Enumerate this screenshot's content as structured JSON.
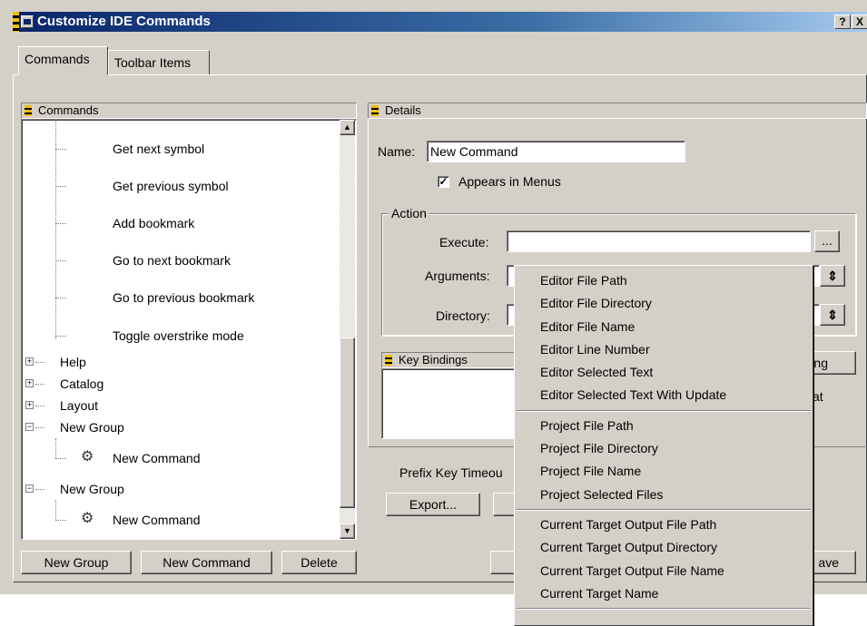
{
  "window": {
    "title": "Customize IDE Commands",
    "help_button": "?",
    "close_button": "X"
  },
  "tabs": [
    {
      "label": "Commands",
      "active": true
    },
    {
      "label": "Toolbar Items",
      "active": false
    }
  ],
  "commands_panel": {
    "header": "Commands",
    "tree": [
      {
        "label": "Get next symbol",
        "level": 2
      },
      {
        "label": "Get previous symbol",
        "level": 2
      },
      {
        "label": "Add bookmark",
        "level": 2
      },
      {
        "label": "Go to next bookmark",
        "level": 2
      },
      {
        "label": "Go to previous bookmark",
        "level": 2
      },
      {
        "label": "Toggle overstrike mode",
        "level": 2
      },
      {
        "label": "Help",
        "level": 0,
        "expander": "+"
      },
      {
        "label": "Catalog",
        "level": 0,
        "expander": "+"
      },
      {
        "label": "Layout",
        "level": 0,
        "expander": "+"
      },
      {
        "label": "New Group",
        "level": 0,
        "expander": "−"
      },
      {
        "label": "New Command",
        "level": 1,
        "icon": "gear-icon"
      },
      {
        "label": "New Group",
        "level": 0,
        "expander": "−"
      },
      {
        "label": "New Command",
        "level": 1,
        "icon": "gear-icon"
      }
    ],
    "scroll_up": "▲",
    "scroll_down": "▼"
  },
  "left_buttons": {
    "new_group": "New Group",
    "new_command": "New Command",
    "delete": "Delete"
  },
  "details": {
    "header": "Details",
    "name_label": "Name:",
    "name_value": "New Command",
    "appears_in_menus": {
      "label": "Appears in Menus",
      "checked": true,
      "mark": "✓"
    },
    "action_legend": "Action",
    "execute_label": "Execute:",
    "execute_value": "",
    "browse_button": "...",
    "arguments_label": "Arguments:",
    "directory_label": "Directory:",
    "spinner_glyph": "⇕"
  },
  "key_bindings": {
    "header": "Key Bindings",
    "button_partial": "ng",
    "text_partial": "at"
  },
  "prefix_key_timeout_label": "Prefix Key Timeou",
  "export_button": "Export...",
  "save_button_partial": "ave",
  "arguments_menu": {
    "groups": [
      [
        "Editor File Path",
        "Editor File Directory",
        "Editor File Name",
        "Editor Line Number",
        "Editor Selected Text",
        "Editor Selected Text With Update"
      ],
      [
        "Project File Path",
        "Project File Directory",
        "Project File Name",
        "Project Selected Files"
      ],
      [
        "Current Target Output File Path",
        "Current Target Output Directory",
        "Current Target Output File Name",
        "Current Target Name"
      ]
    ]
  }
}
